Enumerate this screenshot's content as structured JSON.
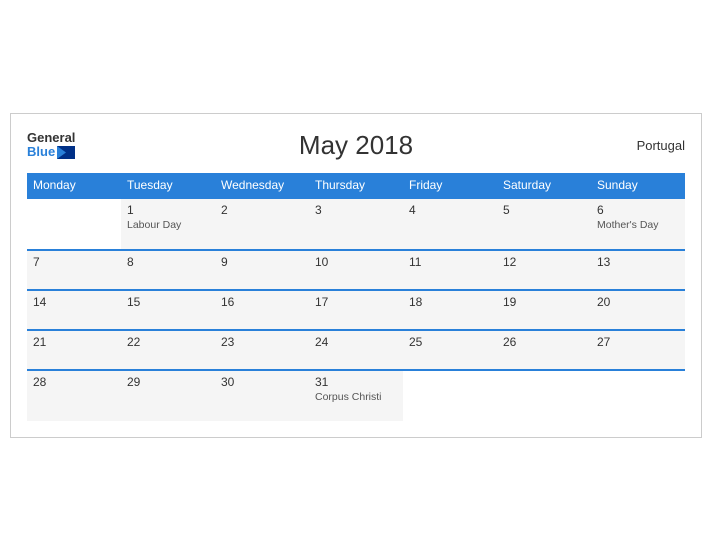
{
  "header": {
    "title": "May 2018",
    "country": "Portugal",
    "logo_general": "General",
    "logo_blue": "Blue"
  },
  "columns": [
    "Monday",
    "Tuesday",
    "Wednesday",
    "Thursday",
    "Friday",
    "Saturday",
    "Sunday"
  ],
  "weeks": [
    [
      {
        "day": "",
        "holiday": "",
        "empty": true
      },
      {
        "day": "1",
        "holiday": "Labour Day"
      },
      {
        "day": "2",
        "holiday": ""
      },
      {
        "day": "3",
        "holiday": ""
      },
      {
        "day": "4",
        "holiday": ""
      },
      {
        "day": "5",
        "holiday": ""
      },
      {
        "day": "6",
        "holiday": "Mother's Day"
      }
    ],
    [
      {
        "day": "7",
        "holiday": ""
      },
      {
        "day": "8",
        "holiday": ""
      },
      {
        "day": "9",
        "holiday": ""
      },
      {
        "day": "10",
        "holiday": ""
      },
      {
        "day": "11",
        "holiday": ""
      },
      {
        "day": "12",
        "holiday": ""
      },
      {
        "day": "13",
        "holiday": ""
      }
    ],
    [
      {
        "day": "14",
        "holiday": ""
      },
      {
        "day": "15",
        "holiday": ""
      },
      {
        "day": "16",
        "holiday": ""
      },
      {
        "day": "17",
        "holiday": ""
      },
      {
        "day": "18",
        "holiday": ""
      },
      {
        "day": "19",
        "holiday": ""
      },
      {
        "day": "20",
        "holiday": ""
      }
    ],
    [
      {
        "day": "21",
        "holiday": ""
      },
      {
        "day": "22",
        "holiday": ""
      },
      {
        "day": "23",
        "holiday": ""
      },
      {
        "day": "24",
        "holiday": ""
      },
      {
        "day": "25",
        "holiday": ""
      },
      {
        "day": "26",
        "holiday": ""
      },
      {
        "day": "27",
        "holiday": ""
      }
    ],
    [
      {
        "day": "28",
        "holiday": ""
      },
      {
        "day": "29",
        "holiday": ""
      },
      {
        "day": "30",
        "holiday": ""
      },
      {
        "day": "31",
        "holiday": "Corpus Christi"
      },
      {
        "day": "",
        "holiday": "",
        "empty": true
      },
      {
        "day": "",
        "holiday": "",
        "empty": true
      },
      {
        "day": "",
        "holiday": "",
        "empty": true
      }
    ]
  ]
}
